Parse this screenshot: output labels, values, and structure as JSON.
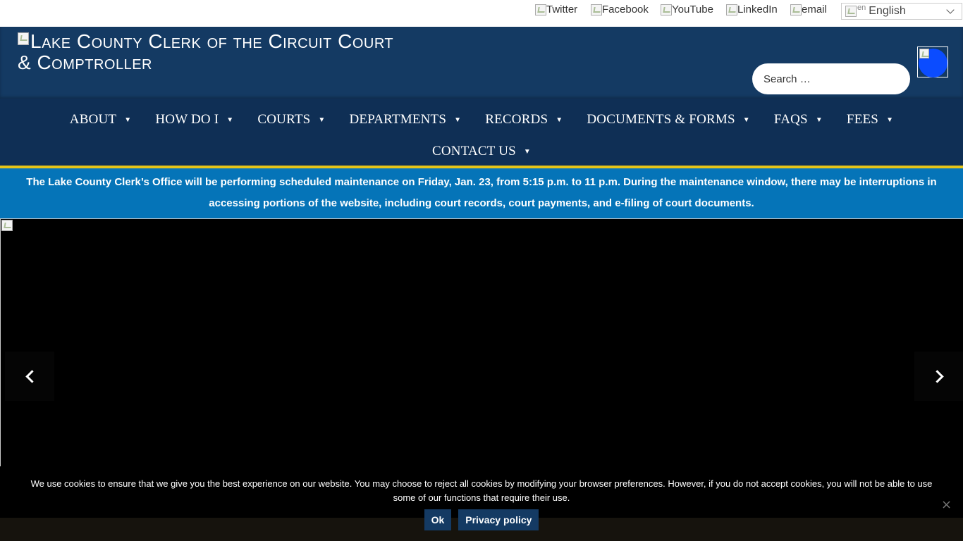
{
  "topbar": {
    "social": [
      {
        "label": "Twitter",
        "icon": "twitter-icon"
      },
      {
        "label": "Facebook",
        "icon": "facebook-icon"
      },
      {
        "label": "YouTube",
        "icon": "youtube-icon"
      },
      {
        "label": "LinkedIn",
        "icon": "linkedin-icon"
      },
      {
        "label": "email",
        "icon": "email-icon"
      }
    ],
    "language": {
      "flag_alt": "en",
      "selected": "English"
    }
  },
  "header": {
    "logo_text": "Lake County Clerk of the Circuit Court & Comptroller",
    "search_placeholder": "Search …",
    "accessibility_color": "#0b4cff"
  },
  "nav": {
    "row1": [
      "ABOUT",
      "HOW DO I",
      "COURTS",
      "DEPARTMENTS",
      "RECORDS",
      "DOCUMENTS & FORMS",
      "FAQS",
      "FEES"
    ],
    "row2": [
      "CONTACT US"
    ]
  },
  "alert": {
    "text": "The Lake County Clerk’s Office will be performing scheduled maintenance on Friday, Jan. 23, from 5:15 p.m. to 11 p.m. During the maintenance window, there may be interruptions in accessing portions of the website, including court records, court payments, and e-filing of court documents."
  },
  "cookie": {
    "text": "We use cookies to ensure that we give you the best experience on our website. You may choose to reject all cookies by modifying your browser preferences. However, if you do not accept cookies, you will not be able to use some of our functions that require their use.",
    "ok_label": "Ok",
    "privacy_label": "Privacy policy",
    "close_label": "×"
  },
  "colors": {
    "header_bg": "#143a63",
    "nav_bg": "#0f2f55",
    "alert_bg": "#0574b8",
    "accent_gold": "#e5c417"
  }
}
